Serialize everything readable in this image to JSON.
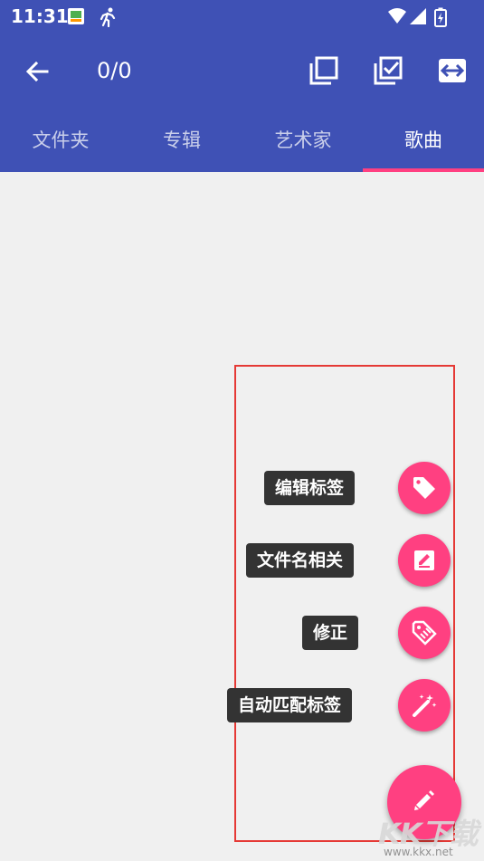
{
  "status_bar": {
    "time": "11:31",
    "icons": [
      "gallery-notification-icon",
      "running-icon",
      "wifi-icon",
      "signal-icon",
      "battery-charging-icon"
    ]
  },
  "toolbar": {
    "count": "0/0",
    "icons": [
      "back-arrow-icon",
      "copy-icon",
      "select-all-icon",
      "swap-horizontal-icon"
    ]
  },
  "tabs": [
    {
      "label": "文件夹",
      "active": false
    },
    {
      "label": "专辑",
      "active": false
    },
    {
      "label": "艺术家",
      "active": false
    },
    {
      "label": "歌曲",
      "active": true
    }
  ],
  "fab_menu": [
    {
      "label": "编辑标签",
      "icon": "tag-icon"
    },
    {
      "label": "文件名相关",
      "icon": "rename-icon"
    },
    {
      "label": "修正",
      "icon": "tag-fix-icon"
    },
    {
      "label": "自动匹配标签",
      "icon": "magic-wand-icon"
    }
  ],
  "fab_main_icon": "edit-pencil-icon",
  "watermark": {
    "big": "KK下载",
    "small": "www.kkx.net"
  },
  "colors": {
    "primary": "#3f51b5",
    "accent": "#ff4081",
    "background": "#f0f0f0",
    "highlight": "#e53935"
  }
}
